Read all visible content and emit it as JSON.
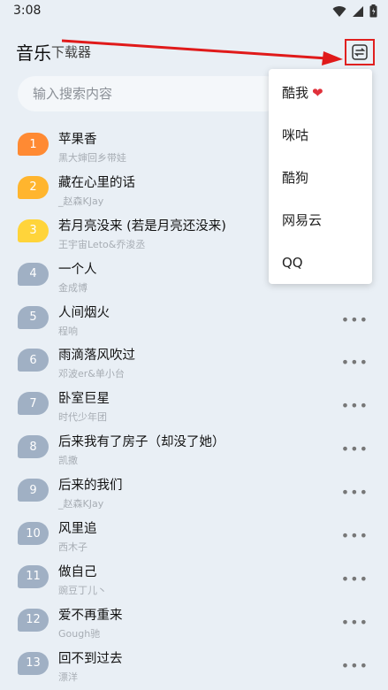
{
  "status": {
    "time": "3:08"
  },
  "header": {
    "title_main": "音乐",
    "title_sub": "下载器"
  },
  "search": {
    "placeholder": "输入搜索内容",
    "value": ""
  },
  "colors": {
    "rank1": "#ff8a33",
    "rank2": "#ffb52e",
    "rank3": "#ffd43a",
    "rank_default": "#a0b0c4",
    "accent_red": "#e02020"
  },
  "songs": [
    {
      "rank": "1",
      "title": "苹果香",
      "artist": "黑大婶回乡带娃"
    },
    {
      "rank": "2",
      "title": "藏在心里的话",
      "artist": "_赵森KJay"
    },
    {
      "rank": "3",
      "title": "若月亮没来 (若是月亮还没来)",
      "artist": "王宇宙Leto&乔浚丞"
    },
    {
      "rank": "4",
      "title": "一个人",
      "artist": "金成博"
    },
    {
      "rank": "5",
      "title": "人间烟火",
      "artist": "程响"
    },
    {
      "rank": "6",
      "title": "雨滴落风吹过",
      "artist": "邓波er&单小台"
    },
    {
      "rank": "7",
      "title": "卧室巨星",
      "artist": "时代少年团"
    },
    {
      "rank": "8",
      "title": "后来我有了房子（却没了她）",
      "artist": "凯撒"
    },
    {
      "rank": "9",
      "title": "后来的我们",
      "artist": "_赵森KJay"
    },
    {
      "rank": "10",
      "title": "风里追",
      "artist": "西木子"
    },
    {
      "rank": "11",
      "title": "做自己",
      "artist": "豌豆丁儿丶"
    },
    {
      "rank": "12",
      "title": "爱不再重来",
      "artist": "Gough驰"
    },
    {
      "rank": "13",
      "title": "回不到过去",
      "artist": "漂洋"
    }
  ],
  "menu": {
    "items": [
      {
        "label": "酷我",
        "icon": "heart-icon"
      },
      {
        "label": "咪咕"
      },
      {
        "label": "酷狗"
      },
      {
        "label": "网易云"
      },
      {
        "label": "QQ"
      }
    ]
  }
}
